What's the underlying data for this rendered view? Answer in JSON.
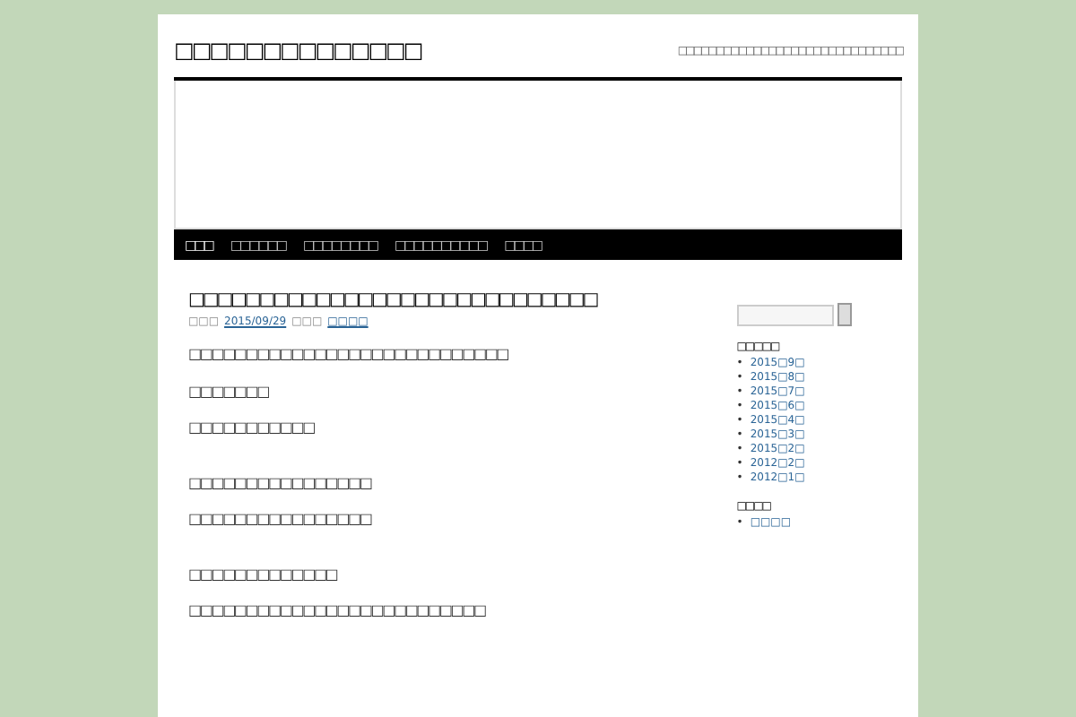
{
  "site": {
    "title": "□□□□□□□□□□□□□□",
    "tagline": "□□□□□□□□□□□□□□□□□□□□□□□□□□□□□□"
  },
  "nav": [
    {
      "label": "□□□",
      "selected": true
    },
    {
      "label": "□□□□□□",
      "selected": false
    },
    {
      "label": "□□□□□□□□",
      "selected": false
    },
    {
      "label": "□□□□□□□□□□",
      "selected": false
    },
    {
      "label": "□□□□",
      "selected": false
    }
  ],
  "post": {
    "title": "□□□□□□□□□□□□□□□□□□□□□□□□□□□□□",
    "meta": {
      "label": "□□□",
      "date": "2015/09/29",
      "by": "□□□",
      "author": "□□□□"
    },
    "sections": [
      [
        "□□□□□□□□□□□□□□□□□□□□□□□□□□□□",
        "□□□□□□□",
        "□□□□□□□□□□□"
      ],
      [
        "□□□□□□□□□□□□□□□□",
        "□□□□□□□□□□□□□□□□"
      ],
      [
        "□□□□□□□□□□□□□",
        "□□□□□□□□□□□□□□□□□□□□□□□□□□"
      ]
    ]
  },
  "sidebar": {
    "widgets": [
      {
        "title": "□□□□□",
        "links": [
          {
            "bullet": "•",
            "text": "2015□9□"
          },
          {
            "bullet": "•",
            "text": "2015□8□"
          },
          {
            "bullet": "•",
            "text": "2015□7□"
          },
          {
            "bullet": "•",
            "text": "2015□6□"
          },
          {
            "bullet": "•",
            "text": "2015□4□"
          },
          {
            "bullet": "•",
            "text": "2015□3□"
          },
          {
            "bullet": "•",
            "text": "2015□2□"
          },
          {
            "bullet": "•",
            "text": "2012□2□"
          },
          {
            "bullet": "•",
            "text": "2012□1□"
          }
        ]
      },
      {
        "title": "□□□□",
        "links": [
          {
            "bullet": "•",
            "text": "□□□□"
          }
        ]
      }
    ]
  }
}
